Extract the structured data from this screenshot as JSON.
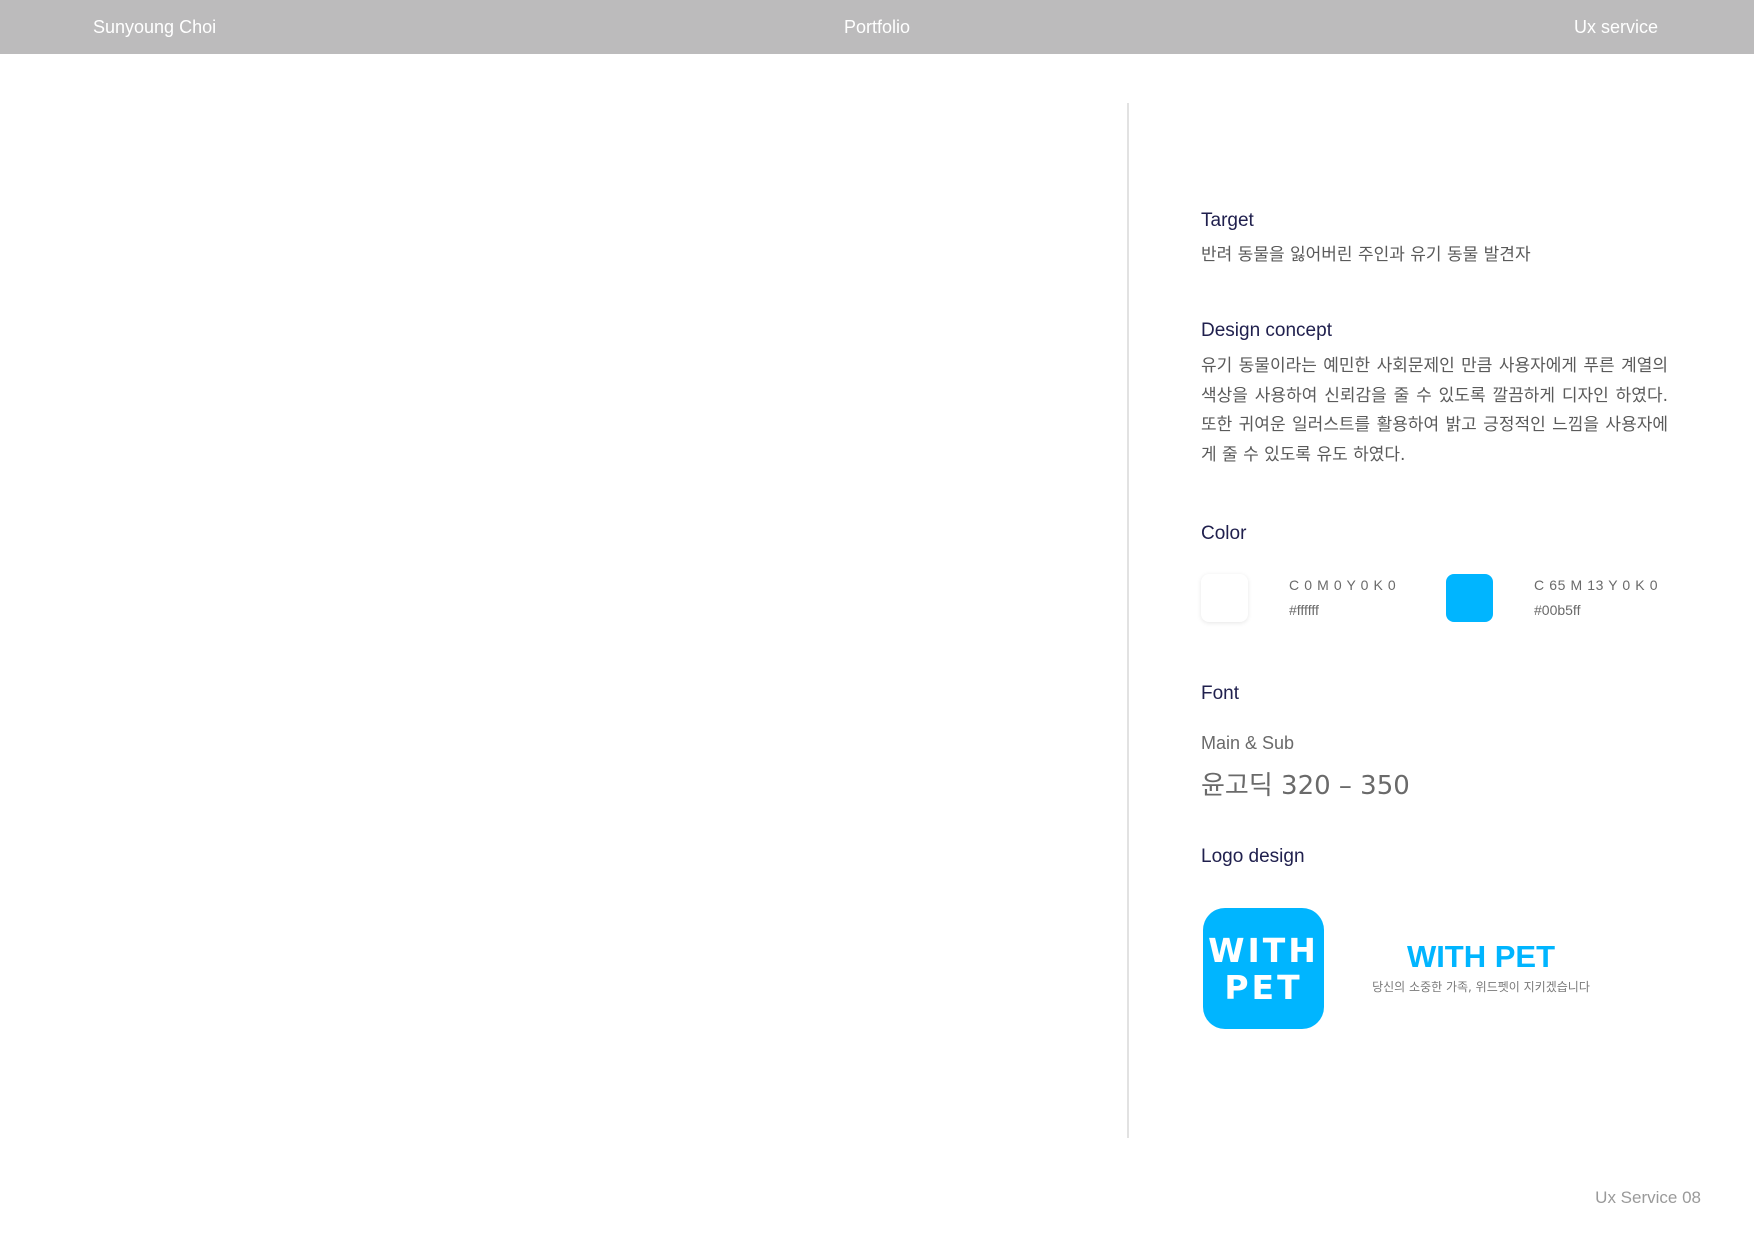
{
  "header": {
    "author": "Sunyoung Choi",
    "center": "Portfolio",
    "section": "Ux service"
  },
  "target": {
    "title": "Target",
    "text": "반려 동물을 잃어버린 주인과 유기 동물 발견자"
  },
  "concept": {
    "title": "Design concept",
    "text": "유기 동물이라는 예민한 사회문제인 만큼 사용자에게 푸른 계열의 색상을 사용하여 신뢰감을 줄 수 있도록 깔끔하게 디자인 하였다. 또한 귀여운 일러스트를 활용하여 밝고 긍정적인 느낌을 사용자에게 줄 수 있도록 유도 하였다."
  },
  "color": {
    "title": "Color",
    "swatches": [
      {
        "cmyk": "C 0 M 0 Y 0 K 0",
        "hex": "#ffffff"
      },
      {
        "cmyk": "C 65 M 13 Y 0 K 0",
        "hex": "#00b5ff"
      }
    ]
  },
  "font": {
    "title": "Font",
    "subtitle": "Main & Sub",
    "sample": "윤고딕 320 – 350"
  },
  "logo": {
    "title": "Logo design",
    "icon_line1": "WITH",
    "icon_line2": "PET",
    "wordmark": "WITH PET",
    "tagline": "당신의 소중한 가족, 위드펫이 지키겠습니다"
  },
  "footer": {
    "page_label": "Ux Service 08"
  },
  "colors": {
    "header_bg": "#bcbbbc",
    "brand_blue": "#00b5ff",
    "heading_navy": "#20204e"
  }
}
